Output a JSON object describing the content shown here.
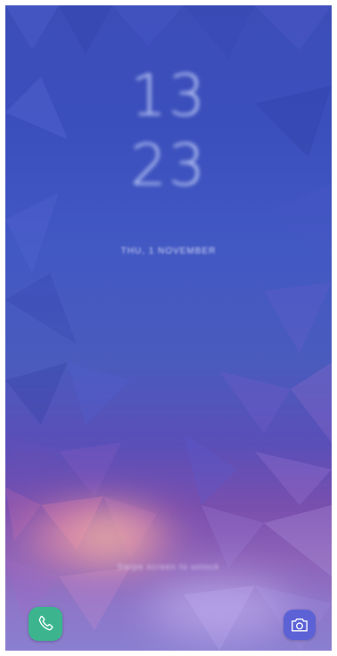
{
  "lock_screen": {
    "clock": {
      "hour": "13",
      "minute": "23"
    },
    "date_text": "THU, 1 NOVEMBER",
    "unlock_hint": "Swipe screen to unlock",
    "shortcuts": {
      "left": {
        "icon": "phone-icon",
        "color": "#3cb58f"
      },
      "right": {
        "icon": "camera-icon",
        "color": "#5c62d6"
      }
    }
  },
  "wallpaper": {
    "colors": [
      "#3d4db8",
      "#4a5bbd",
      "#7a4fae",
      "#ff9aa0",
      "#8a7fd0"
    ]
  }
}
